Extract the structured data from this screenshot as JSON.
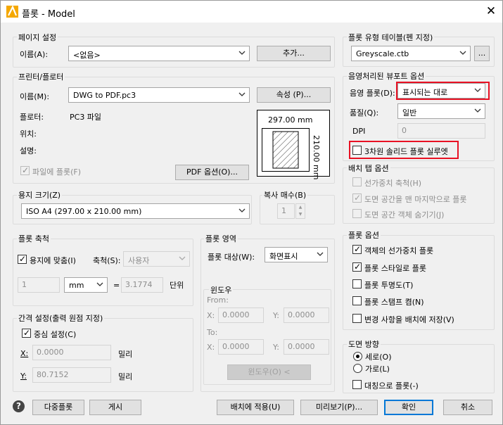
{
  "window": {
    "title": "플롯 - Model",
    "close_label": "✕"
  },
  "page_setup": {
    "group_label": "페이지 설정",
    "name_label": "이름(A):",
    "name_value": "<없음>",
    "add_button": "추가..."
  },
  "printer": {
    "group_label": "프린터/플로터",
    "name_label": "이름(M):",
    "name_value": "DWG to PDF.pc3",
    "properties_button": "속성 (P)...",
    "plotter_label": "플로터:",
    "plotter_value": "PC3 파일",
    "location_label": "위치:",
    "description_label": "설명:",
    "plot_to_file_label": "파일에 플롯(F)",
    "pdf_options_button": "PDF 옵션(O)...",
    "preview_width": "297.00 mm",
    "preview_height": "210.00 mm"
  },
  "paper_size": {
    "group_label": "용지 크기(Z)",
    "value": "ISO A4 (297.00 x 210.00 mm)"
  },
  "copies": {
    "group_label": "복사 매수(B)",
    "value": "1"
  },
  "plot_scale": {
    "group_label": "플롯 축척",
    "fit_label": "용지에 맞춤(I)",
    "scale_label": "축척(S):",
    "scale_value": "사용자",
    "value1": "1",
    "unit_value": "mm",
    "equals": "=",
    "value2": "3.1774",
    "unit_label": "단위"
  },
  "plot_area": {
    "group_label": "플롯 영역",
    "what_label": "플롯 대상(W):",
    "what_value": "화면표시"
  },
  "window_sub": {
    "group_label": "윈도우",
    "from_label": "From:",
    "to_label": "To:",
    "x_label": "X:",
    "y_label": "Y:",
    "from_x": "0.0000",
    "from_y": "0.0000",
    "to_x": "0.0000",
    "to_y": "0.0000",
    "button": "윈도우(O) <"
  },
  "offset": {
    "group_label": "간격 설정(출력 원점 지정)",
    "center_label": "중심 설정(C)",
    "x_label": "X:",
    "x_value": "0.0000",
    "x_unit": "밀리",
    "y_label": "Y:",
    "y_value": "80.7152",
    "y_unit": "밀리"
  },
  "style_table": {
    "group_label": "플롯 유형 테이블(펜 지정)",
    "value": "Greyscale.ctb",
    "browse_button": "..."
  },
  "viewport": {
    "group_label": "음영처리된 뷰포트 옵션",
    "shade_label": "음영 플롯(D):",
    "shade_value": "표시되는 대로",
    "quality_label": "품질(Q):",
    "quality_value": "일반",
    "dpi_label": "DPI",
    "dpi_value": "0",
    "solid_label": "3차원 솔리드 플롯 실루엣"
  },
  "layout_tab": {
    "group_label": "배치 탭 옵션",
    "item1": "선가중치 축척(H)",
    "item2": "도면 공간을 맨 마지막으로 플롯",
    "item3": "도면 공간 객체 숨기기(J)"
  },
  "plot_options": {
    "group_label": "플롯 옵션",
    "opt1": "객체의 선가중치 플롯",
    "opt2": "플롯 스타일로 플롯",
    "opt3": "플롯 투명도(T)",
    "opt4": "플롯 스탬프 켬(N)",
    "opt5": "변경 사항을 배치에 저장(V)"
  },
  "orientation": {
    "group_label": "도면 방향",
    "portrait": "세로(O)",
    "landscape": "가로(L)",
    "upside": "대칭으로 플롯(-)"
  },
  "footer": {
    "help": "?",
    "batch": "다중플롯",
    "publish": "게시",
    "apply": "배치에 적용(U)",
    "preview": "미리보기(P)...",
    "ok": "확인",
    "cancel": "취소"
  },
  "colors": {
    "accent": "#0078d7",
    "highlight": "#e81123"
  }
}
